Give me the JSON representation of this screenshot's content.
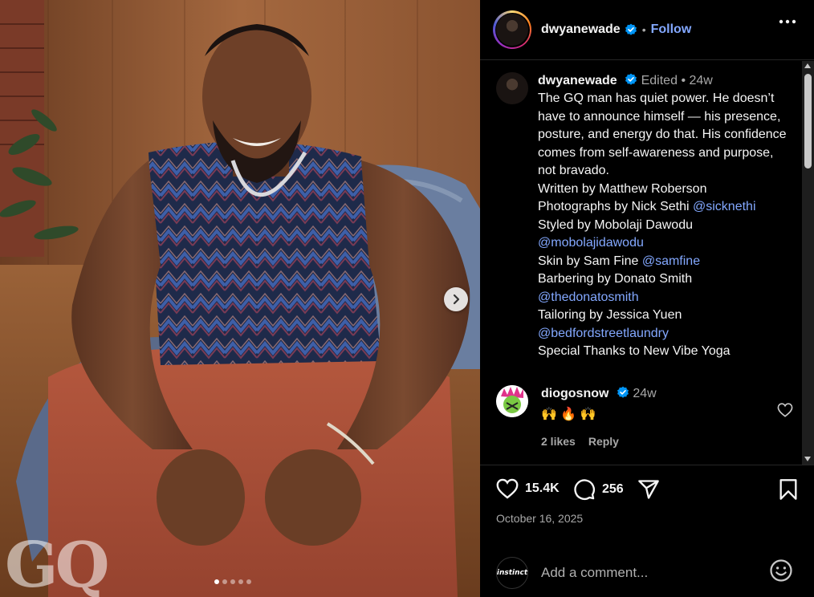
{
  "post": {
    "username": "dwyanewade",
    "follow_label": "Follow",
    "separator": "•",
    "edited_label": "Edited",
    "time_ago": "24w",
    "watermark": "GQ",
    "slide_count": 5,
    "active_slide": 1
  },
  "caption": {
    "lines": [
      {
        "text": "The GQ man has quiet power. He doesn’t have to announce himself — his presence, posture, and energy do that. His confidence comes from self-awareness and purpose, not bravado."
      },
      {
        "text": "Written by Matthew Roberson"
      },
      {
        "text": "Photographs by Nick Sethi ",
        "mention": "@sicknethi"
      },
      {
        "text": "Styled by Mobolaji Dawodu ",
        "mention": "@mobolajidawodu"
      },
      {
        "text": "Skin by Sam Fine ",
        "mention": "@samfine"
      },
      {
        "text": "Barbering by Donato Smith ",
        "mention": "@thedonatosmith"
      },
      {
        "text": "Tailoring by Jessica Yuen ",
        "mention": "@bedfordstreetlaundry"
      },
      {
        "text": "Special Thanks to New Vibe Yoga"
      }
    ]
  },
  "comment": {
    "username": "diogosnow",
    "time_ago": "24w",
    "emojis": "🙌 🔥 🙌",
    "likes": "2 likes",
    "reply_label": "Reply"
  },
  "stats": {
    "likes": "15.4K",
    "comments": "256",
    "date": "October 16, 2025"
  },
  "composer": {
    "avatar_text": "instinct",
    "placeholder": "Add a comment..."
  },
  "colors": {
    "link": "#83a8ff",
    "verified": "#0095f6",
    "background": "#000000"
  }
}
